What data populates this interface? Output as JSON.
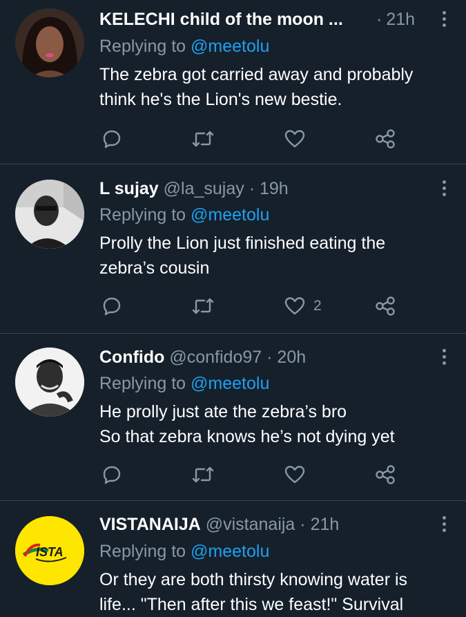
{
  "colors": {
    "background": "#15202b",
    "divider": "#38444d",
    "secondary_text": "#8899a6",
    "mention": "#1da1f2",
    "primary_text": "#ffffff"
  },
  "tweets": [
    {
      "name": "KELECHI child of the moon ...",
      "handle": "",
      "separator": "·",
      "time": "21h",
      "replying_label": "Replying to",
      "replying_to": "@meetolu",
      "lines": [
        "The zebra got carried away and probably",
        "think he's the Lion's new bestie."
      ],
      "like_count": ""
    },
    {
      "name": "L sujay",
      "handle": "@la_sujay",
      "separator": "·",
      "time": "19h",
      "replying_label": "Replying to",
      "replying_to": "@meetolu",
      "lines": [
        "Prolly the Lion just finished eating the",
        "zebra’s cousin"
      ],
      "like_count": "2"
    },
    {
      "name": "Confido",
      "handle": "@confido97",
      "separator": "·",
      "time": "20h",
      "replying_label": "Replying to",
      "replying_to": "@meetolu",
      "lines": [
        "He prolly just ate the zebra’s bro",
        "So that zebra knows he’s not dying yet"
      ],
      "like_count": ""
    },
    {
      "name": "VISTANAIJA",
      "handle": "@vistanaija",
      "separator": "·",
      "time": "21h",
      "replying_label": "Replying to",
      "replying_to": "@meetolu",
      "lines": [
        "Or they are both thirsty knowing water is",
        "life... \"Then after this we feast!\" Survival"
      ],
      "like_count": "",
      "avatar_logo_text": "ISTA"
    }
  ],
  "icons": [
    "reply-icon",
    "retweet-icon",
    "like-icon",
    "share-icon",
    "more-icon"
  ]
}
